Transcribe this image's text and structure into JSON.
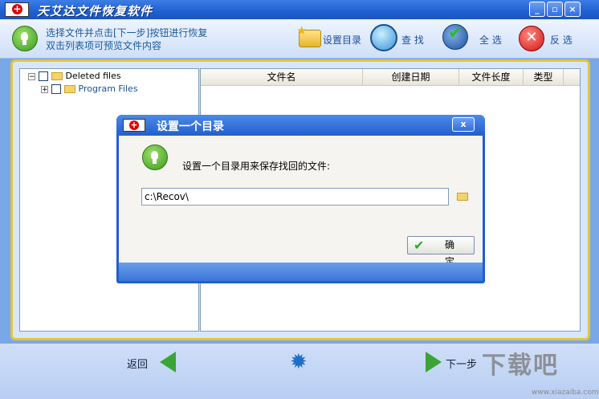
{
  "app": {
    "title": "天艾达文件恢复软件",
    "window_buttons": {
      "minimize": "_",
      "restore": "▫",
      "close": "×"
    }
  },
  "toolbar": {
    "hint_line1": "选择文件并点击[下一步]按钮进行恢复",
    "hint_line2": "双击列表项可预览文件内容",
    "set_dir_label": "设置目录",
    "find_label": "查 找",
    "select_all_label": "全 选",
    "invert_label": "反 选",
    "icons": [
      "bulb-icon",
      "folder-star-icon",
      "magnifier-icon",
      "check-globe-icon",
      "red-x-icon"
    ]
  },
  "tree": {
    "items": [
      {
        "expander": "−",
        "label": "Deleted files"
      },
      {
        "expander": "+",
        "label": "Program Files"
      }
    ]
  },
  "list": {
    "columns": [
      "文件名",
      "创建日期",
      "文件长度",
      "类型"
    ],
    "rows": []
  },
  "nav": {
    "back_label": "返回",
    "next_label": "下一步"
  },
  "dialog": {
    "title": "设置一个目录",
    "message": "设置一个目录用来保存找回的文件:",
    "path_value": "c:\\Recov\\",
    "ok_label": "确定",
    "close_glyph": "x"
  },
  "watermark": {
    "text": "下载吧",
    "url": "www.xiazaiba.com"
  },
  "colors": {
    "titlebar": "#1f5fd0",
    "frame_border": "#e4c53a",
    "accent_green": "#3aa534"
  }
}
